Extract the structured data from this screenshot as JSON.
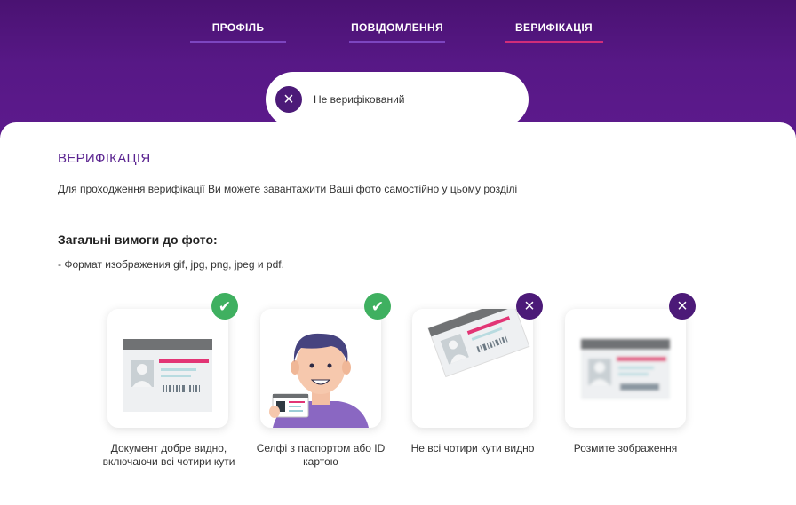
{
  "tabs": [
    {
      "label": "ПРОФІЛЬ"
    },
    {
      "label": "ПОВІДОМЛЕННЯ"
    },
    {
      "label": "ВЕРИФІКАЦІЯ"
    }
  ],
  "status": {
    "text": "Не верифікований",
    "icon": "close-icon"
  },
  "verification": {
    "title": "ВЕРИФІКАЦІЯ",
    "description": "Для проходження верифікації Ви можете завантажити Ваші фото самостійно у цьому розділі",
    "requirements_title": "Загальні вимоги до фото:",
    "requirement_1": "- Формат изображения gif, jpg, png, jpeg и pdf."
  },
  "examples": [
    {
      "caption": "Документ добре видно, включаючи всі чотири кути",
      "status": "ok",
      "icon": "check-icon"
    },
    {
      "caption": "Селфі з паспортом або ID картою",
      "status": "ok",
      "icon": "check-icon"
    },
    {
      "caption": "Не всі чотири кути видно",
      "status": "bad",
      "icon": "close-icon"
    },
    {
      "caption": "Розмите зображення",
      "status": "bad",
      "icon": "close-icon"
    }
  ],
  "colors": {
    "brand_purple": "#571886",
    "accent_pink": "#d12d79",
    "ok_green": "#3fb060"
  }
}
